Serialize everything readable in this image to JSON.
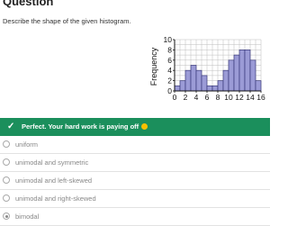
{
  "question": {
    "heading": "Question",
    "prompt": "Describe the shape of the given histogram."
  },
  "chart_data": {
    "type": "bar",
    "ylabel": "Frequency",
    "xlabel": "",
    "bin_width": 1,
    "bin_starts": [
      0,
      1,
      2,
      3,
      4,
      5,
      6,
      7,
      8,
      9,
      10,
      11,
      12,
      13,
      14,
      15
    ],
    "values": [
      1,
      2,
      4,
      5,
      4,
      3,
      1,
      1,
      2,
      4,
      6,
      7,
      8,
      8,
      6,
      2
    ],
    "x_ticks": [
      "0",
      "2",
      "4",
      "6",
      "8",
      "10",
      "12",
      "14",
      "16"
    ],
    "y_ticks": [
      "0",
      "2",
      "4",
      "6",
      "8",
      "10"
    ],
    "xlim": [
      0,
      16
    ],
    "ylim": [
      0,
      10
    ],
    "grid": true,
    "bar_color": "#9b9bd6",
    "bar_edge_color": "#3a3a7a"
  },
  "feedback": {
    "icon": "checkmark",
    "message": "Perfect. Your hard work is paying off",
    "emoji": "smiley-face",
    "color": "#1b8f5c"
  },
  "options": [
    {
      "label": "uniform",
      "selected": false
    },
    {
      "label": "unimodal and symmetric",
      "selected": false
    },
    {
      "label": "unimodal and left-skewed",
      "selected": false
    },
    {
      "label": "unimodal and right-skewed",
      "selected": false
    },
    {
      "label": "bimodal",
      "selected": true
    }
  ]
}
